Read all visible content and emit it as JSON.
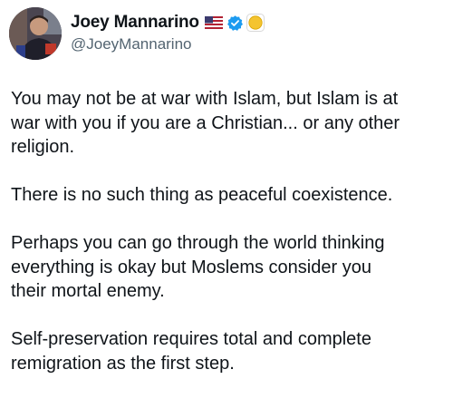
{
  "author": {
    "display_name": "Joey Mannarino",
    "handle": "@JoeyMannarino",
    "badges": [
      "us-flag-icon",
      "verified-badge-icon",
      "gold-affiliate-badge-icon"
    ]
  },
  "colors": {
    "text": "#0f1419",
    "handle": "#536471",
    "verified_blue": "#1d9bf0",
    "affiliate_gold": "#f4c430"
  },
  "tweet": {
    "paragraphs": [
      "You may not be at war with Islam, but Islam is at\nwar with you if you are a Christian... or any other\nreligion.",
      "There is no such thing as peaceful coexistence.",
      "Perhaps you can go through the world thinking\neverything is okay but Moslems consider you\ntheir mortal enemy.",
      "Self-preservation requires total and complete\nremigration as the first step."
    ]
  }
}
